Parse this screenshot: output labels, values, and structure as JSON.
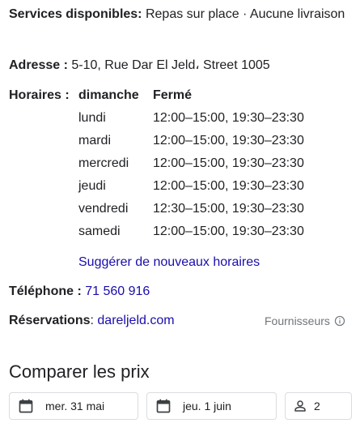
{
  "services": {
    "label": "Services disponibles:",
    "value": "Repas sur place · Aucune livraison"
  },
  "address": {
    "label": "Adresse :",
    "value": "5-10, Rue Dar El Jeld، Street 1005"
  },
  "hours": {
    "label": "Horaires :",
    "rows": [
      {
        "day": "dimanche",
        "time": "Fermé"
      },
      {
        "day": "lundi",
        "time": "12:00–15:00, 19:30–23:30"
      },
      {
        "day": "mardi",
        "time": "12:00–15:00, 19:30–23:30"
      },
      {
        "day": "mercredi",
        "time": "12:00–15:00, 19:30–23:30"
      },
      {
        "day": "jeudi",
        "time": "12:00–15:00, 19:30–23:30"
      },
      {
        "day": "vendredi",
        "time": "12:30–15:00, 19:30–23:30"
      },
      {
        "day": "samedi",
        "time": "12:00–15:00, 19:30–23:30"
      }
    ],
    "suggest_link": "Suggérer de nouveaux horaires"
  },
  "phone": {
    "label": "Téléphone :",
    "value": "71 560 916"
  },
  "reservations": {
    "label": "Réservations",
    "separator": ":",
    "value": "dareljeld.com"
  },
  "providers": {
    "label": "Fournisseurs",
    "icon": "info-icon"
  },
  "compare": {
    "title": "Comparer les prix",
    "checkin": {
      "icon": "calendar-icon",
      "value": "mer. 31 mai"
    },
    "checkout": {
      "icon": "calendar-icon",
      "value": "jeu. 1 juin"
    },
    "guests": {
      "icon": "person-icon",
      "value": "2"
    }
  },
  "colors": {
    "link": "#1a0dab",
    "text": "#202124",
    "muted": "#70757a",
    "border": "#dadce0"
  }
}
